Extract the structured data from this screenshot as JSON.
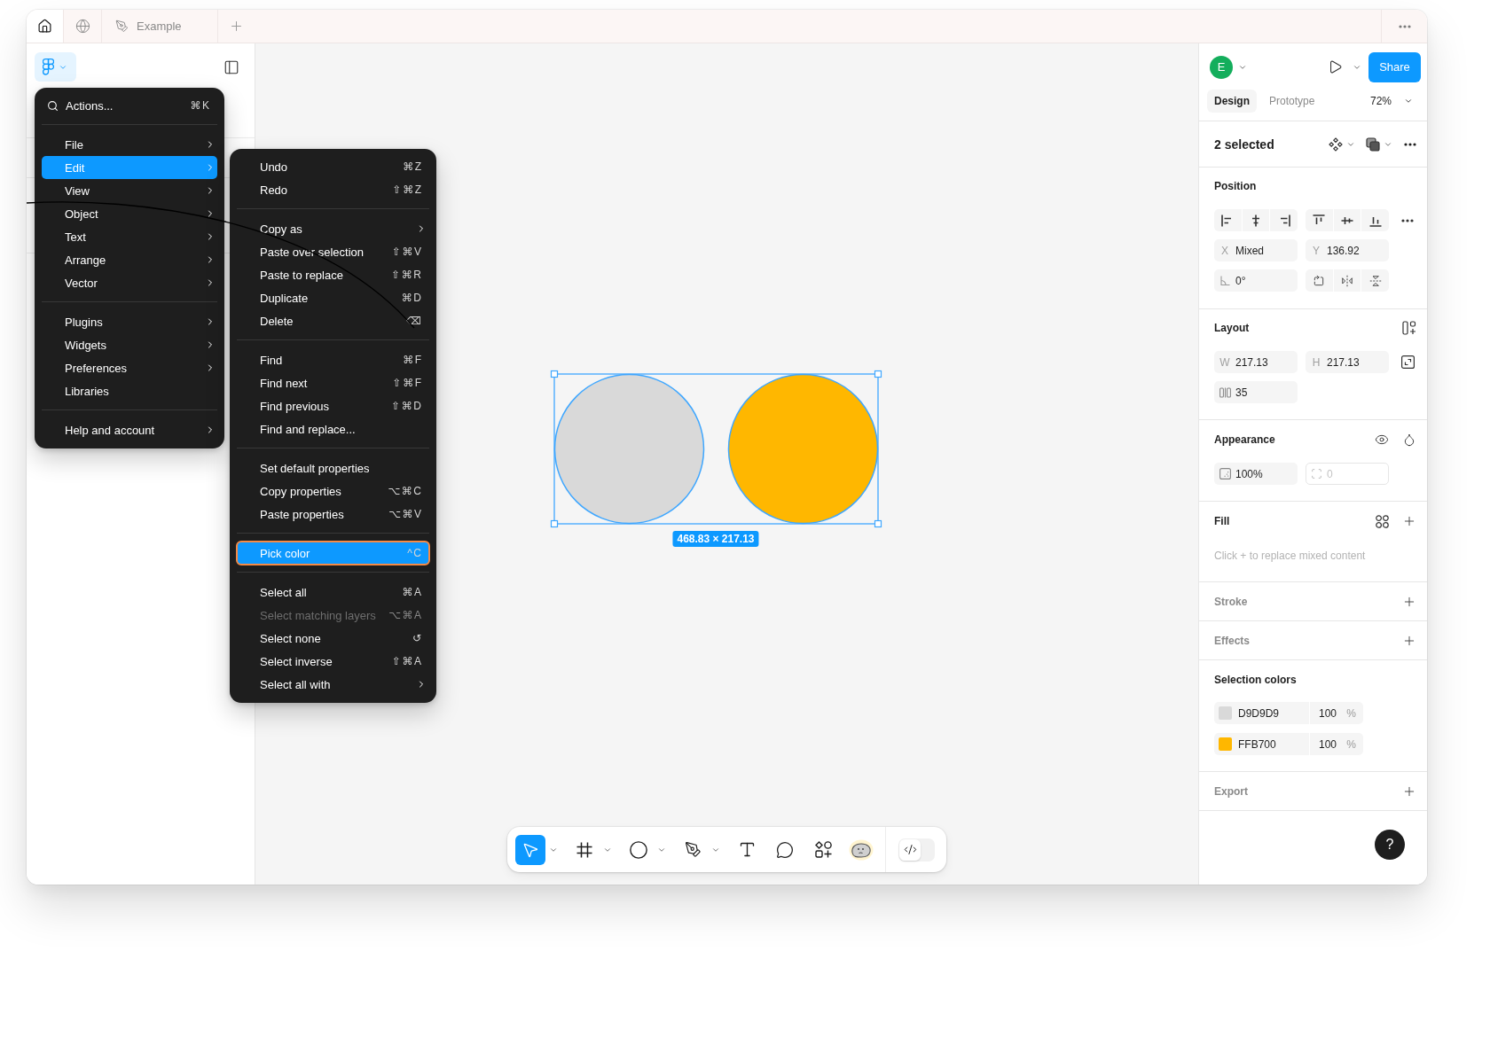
{
  "tabs": [
    {
      "kind": "home",
      "selected": true
    },
    {
      "kind": "globe",
      "selected": false
    },
    {
      "kind": "file",
      "label": "Example",
      "selected": false
    }
  ],
  "main_menu": {
    "search": {
      "label": "Actions...",
      "shortcut": "⌘K"
    },
    "groups": [
      [
        {
          "label": "File",
          "submenu": true,
          "selected": false
        },
        {
          "label": "Edit",
          "submenu": true,
          "selected": true
        },
        {
          "label": "View",
          "submenu": true,
          "selected": false
        },
        {
          "label": "Object",
          "submenu": true,
          "selected": false
        },
        {
          "label": "Text",
          "submenu": true,
          "selected": false
        },
        {
          "label": "Arrange",
          "submenu": true,
          "selected": false
        },
        {
          "label": "Vector",
          "submenu": true,
          "selected": false
        }
      ],
      [
        {
          "label": "Plugins",
          "submenu": true,
          "selected": false
        },
        {
          "label": "Widgets",
          "submenu": true,
          "selected": false
        },
        {
          "label": "Preferences",
          "submenu": true,
          "selected": false
        },
        {
          "label": "Libraries",
          "submenu": false,
          "selected": false
        }
      ],
      [
        {
          "label": "Help and account",
          "submenu": true,
          "selected": false
        }
      ]
    ]
  },
  "edit_menu": {
    "groups": [
      [
        {
          "label": "Undo",
          "shortcut": "⌘Z",
          "submenu": false,
          "disabled": false,
          "selected": false
        },
        {
          "label": "Redo",
          "shortcut": "⇧⌘Z",
          "submenu": false,
          "disabled": false,
          "selected": false
        }
      ],
      [
        {
          "label": "Copy as",
          "submenu": true,
          "disabled": false,
          "selected": false
        },
        {
          "label": "Paste over selection",
          "shortcut": "⇧⌘V",
          "submenu": false,
          "disabled": false,
          "selected": false
        },
        {
          "label": "Paste to replace",
          "shortcut": "⇧⌘R",
          "submenu": false,
          "disabled": false,
          "selected": false
        },
        {
          "label": "Duplicate",
          "shortcut": "⌘D",
          "submenu": false,
          "disabled": false,
          "selected": false
        },
        {
          "label": "Delete",
          "shortcut": "⌫",
          "submenu": false,
          "disabled": false,
          "selected": false
        }
      ],
      [
        {
          "label": "Find",
          "shortcut": "⌘F",
          "submenu": false,
          "disabled": false,
          "selected": false
        },
        {
          "label": "Find next",
          "shortcut": "⇧⌘F",
          "submenu": false,
          "disabled": false,
          "selected": false
        },
        {
          "label": "Find previous",
          "shortcut": "⇧⌘D",
          "submenu": false,
          "disabled": false,
          "selected": false
        },
        {
          "label": "Find and replace...",
          "submenu": false,
          "disabled": false,
          "selected": false
        }
      ],
      [
        {
          "label": "Set default properties",
          "submenu": false,
          "disabled": false,
          "selected": false
        },
        {
          "label": "Copy properties",
          "shortcut": "⌥⌘C",
          "submenu": false,
          "disabled": false,
          "selected": false
        },
        {
          "label": "Paste properties",
          "shortcut": "⌥⌘V",
          "submenu": false,
          "disabled": false,
          "selected": false
        }
      ],
      [
        {
          "label": "Pick color",
          "shortcut": "^C",
          "submenu": false,
          "disabled": false,
          "selected": true
        }
      ],
      [
        {
          "label": "Select all",
          "shortcut": "⌘A",
          "submenu": false,
          "disabled": false,
          "selected": false
        },
        {
          "label": "Select matching layers",
          "shortcut": "⌥⌘A",
          "submenu": false,
          "disabled": true,
          "selected": false
        },
        {
          "label": "Select none",
          "shortcut": "↺",
          "submenu": false,
          "disabled": false,
          "selected": false
        },
        {
          "label": "Select inverse",
          "shortcut": "⇧⌘A",
          "submenu": false,
          "disabled": false,
          "selected": false
        },
        {
          "label": "Select all with",
          "submenu": true,
          "disabled": false,
          "selected": false
        }
      ]
    ]
  },
  "canvas": {
    "shapes": [
      {
        "color": "#d9d9d9"
      },
      {
        "color": "#ffb700"
      }
    ],
    "size_label": "468.83 × 217.13"
  },
  "toolbar": {
    "tools": [
      {
        "kind": "move",
        "menu": true,
        "selected": true
      },
      {
        "kind": "frame",
        "menu": true,
        "selected": false
      },
      {
        "kind": "ellipse",
        "menu": true,
        "selected": false
      },
      {
        "kind": "pen",
        "menu": true,
        "selected": false
      },
      {
        "kind": "text",
        "menu": false,
        "selected": false
      },
      {
        "kind": "comment",
        "menu": false,
        "selected": false
      },
      {
        "kind": "actions",
        "menu": false,
        "selected": false
      },
      {
        "kind": "assistant",
        "menu": false,
        "selected": false
      }
    ],
    "dev_mode": {
      "on": false
    }
  },
  "right_panel": {
    "avatar": "E",
    "share": "Share",
    "tabs": [
      {
        "label": "Design",
        "selected": true
      },
      {
        "label": "Prototype",
        "selected": false
      }
    ],
    "zoom": "72%",
    "selection_title": "2 selected",
    "position": {
      "title": "Position",
      "fields": [
        {
          "label": "X",
          "value": "Mixed"
        },
        {
          "label": "Y",
          "value": "136.92"
        }
      ],
      "rotation": "0°"
    },
    "layout": {
      "title": "Layout",
      "fields": [
        {
          "label": "W",
          "value": "217.13"
        },
        {
          "label": "H",
          "value": "217.13"
        }
      ],
      "gap": "35"
    },
    "appearance": {
      "title": "Appearance",
      "opacity": "100%",
      "corner_radius": {
        "placeholder": "0"
      }
    },
    "fill": {
      "title": "Fill",
      "hint": "Click + to replace mixed content"
    },
    "stroke": {
      "title": "Stroke"
    },
    "effects": {
      "title": "Effects"
    },
    "selection_colors": {
      "title": "Selection colors",
      "items": [
        {
          "hex": "D9D9D9",
          "opacity": "100",
          "unit": "%",
          "color": "#d9d9d9"
        },
        {
          "hex": "FFB700",
          "opacity": "100",
          "unit": "%",
          "color": "#ffb700"
        }
      ]
    },
    "export": {
      "title": "Export"
    },
    "help": "?"
  }
}
